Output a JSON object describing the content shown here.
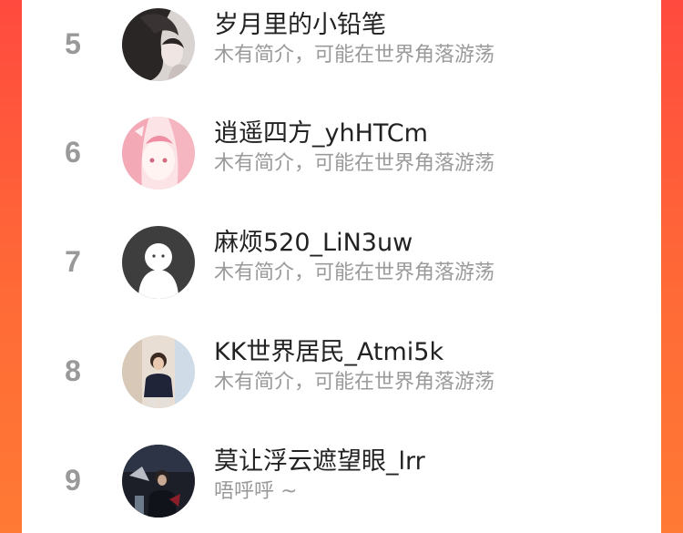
{
  "rankings": [
    {
      "rank": "5",
      "name": "岁月里的小铅笔",
      "bio": "木有简介，可能在世界角落游荡",
      "avatar_icon": "dark-hair-portrait-avatar"
    },
    {
      "rank": "6",
      "name": "逍遥四方_yhHTCm",
      "bio": "木有简介，可能在世界角落游荡",
      "avatar_icon": "pink-anime-avatar"
    },
    {
      "rank": "7",
      "name": "麻烦520_LiN3uw",
      "bio": "木有简介，可能在世界角落游荡",
      "avatar_icon": "default-ghost-avatar"
    },
    {
      "rank": "8",
      "name": "KK世界居民_Atmi5k",
      "bio": "木有简介，可能在世界角落游荡",
      "avatar_icon": "person-photo-avatar"
    },
    {
      "rank": "9",
      "name": "莫让浮云遮望眼_lrr",
      "bio": "唔呼呼 ~",
      "avatar_icon": "dark-photo-avatar"
    }
  ],
  "colors": {
    "background_gradient_top": "#ff4a3f",
    "background_gradient_bottom": "#ff7a34",
    "rank_color": "#999999",
    "name_color": "#222222",
    "bio_color": "#9a9a9a"
  }
}
